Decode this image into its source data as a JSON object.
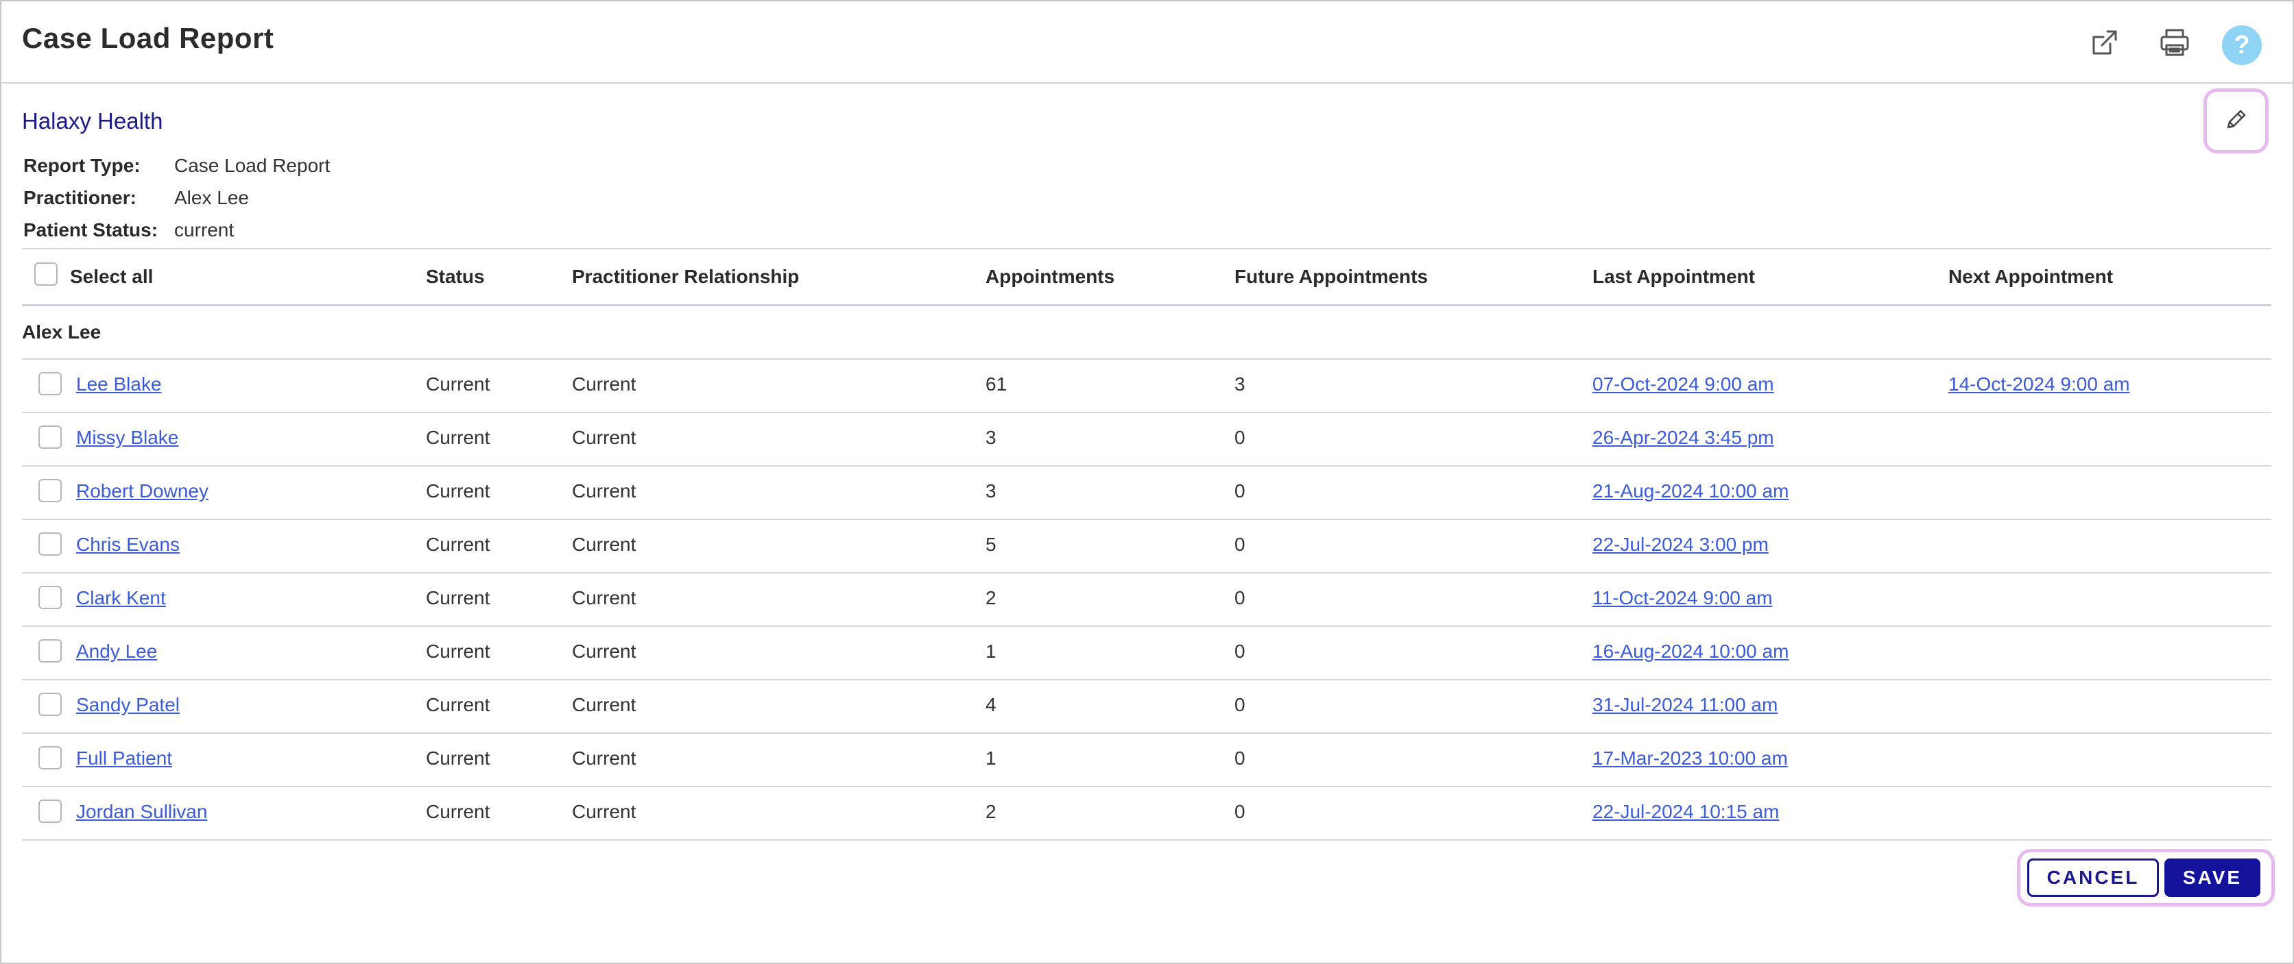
{
  "header": {
    "title": "Case Load Report",
    "actions": [
      {
        "name": "open-external-icon"
      },
      {
        "name": "print-icon"
      },
      {
        "name": "help-icon",
        "label": "?"
      }
    ]
  },
  "report": {
    "organization": "Halaxy Health",
    "meta": [
      {
        "label": "Report Type:",
        "value": "Case Load Report"
      },
      {
        "label": "Practitioner:",
        "value": "Alex Lee"
      },
      {
        "label": "Patient Status:",
        "value": "current"
      }
    ]
  },
  "table": {
    "select_all_label": "Select all",
    "columns": {
      "status": "Status",
      "relationship": "Practitioner Relationship",
      "appointments": "Appointments",
      "future": "Future Appointments",
      "last": "Last Appointment",
      "next": "Next Appointment"
    },
    "group_label": "Alex Lee",
    "rows": [
      {
        "name": "Lee Blake",
        "status": "Current",
        "relationship": "Current",
        "appointments": "61",
        "future": "3",
        "last": "07-Oct-2024 9:00 am",
        "next": "14-Oct-2024 9:00 am"
      },
      {
        "name": "Missy Blake",
        "status": "Current",
        "relationship": "Current",
        "appointments": "3",
        "future": "0",
        "last": "26-Apr-2024 3:45 pm",
        "next": ""
      },
      {
        "name": "Robert Downey",
        "status": "Current",
        "relationship": "Current",
        "appointments": "3",
        "future": "0",
        "last": "21-Aug-2024 10:00 am",
        "next": ""
      },
      {
        "name": "Chris Evans",
        "status": "Current",
        "relationship": "Current",
        "appointments": "5",
        "future": "0",
        "last": "22-Jul-2024 3:00 pm",
        "next": ""
      },
      {
        "name": "Clark Kent",
        "status": "Current",
        "relationship": "Current",
        "appointments": "2",
        "future": "0",
        "last": "11-Oct-2024 9:00 am",
        "next": ""
      },
      {
        "name": "Andy Lee",
        "status": "Current",
        "relationship": "Current",
        "appointments": "1",
        "future": "0",
        "last": "16-Aug-2024 10:00 am",
        "next": ""
      },
      {
        "name": "Sandy Patel",
        "status": "Current",
        "relationship": "Current",
        "appointments": "4",
        "future": "0",
        "last": "31-Jul-2024 11:00 am",
        "next": ""
      },
      {
        "name": "Full Patient",
        "status": "Current",
        "relationship": "Current",
        "appointments": "1",
        "future": "0",
        "last": "17-Mar-2023 10:00 am",
        "next": ""
      },
      {
        "name": "Jordan Sullivan",
        "status": "Current",
        "relationship": "Current",
        "appointments": "2",
        "future": "0",
        "last": "22-Jul-2024 10:15 am",
        "next": ""
      }
    ]
  },
  "footer": {
    "cancel_label": "CANCEL",
    "save_label": "SAVE"
  },
  "colors": {
    "accent": "#12129a",
    "link": "#3b5bdb",
    "org_name": "#1a1a8c",
    "highlight": "#e8b8f0",
    "help": "#8fd3f5"
  }
}
